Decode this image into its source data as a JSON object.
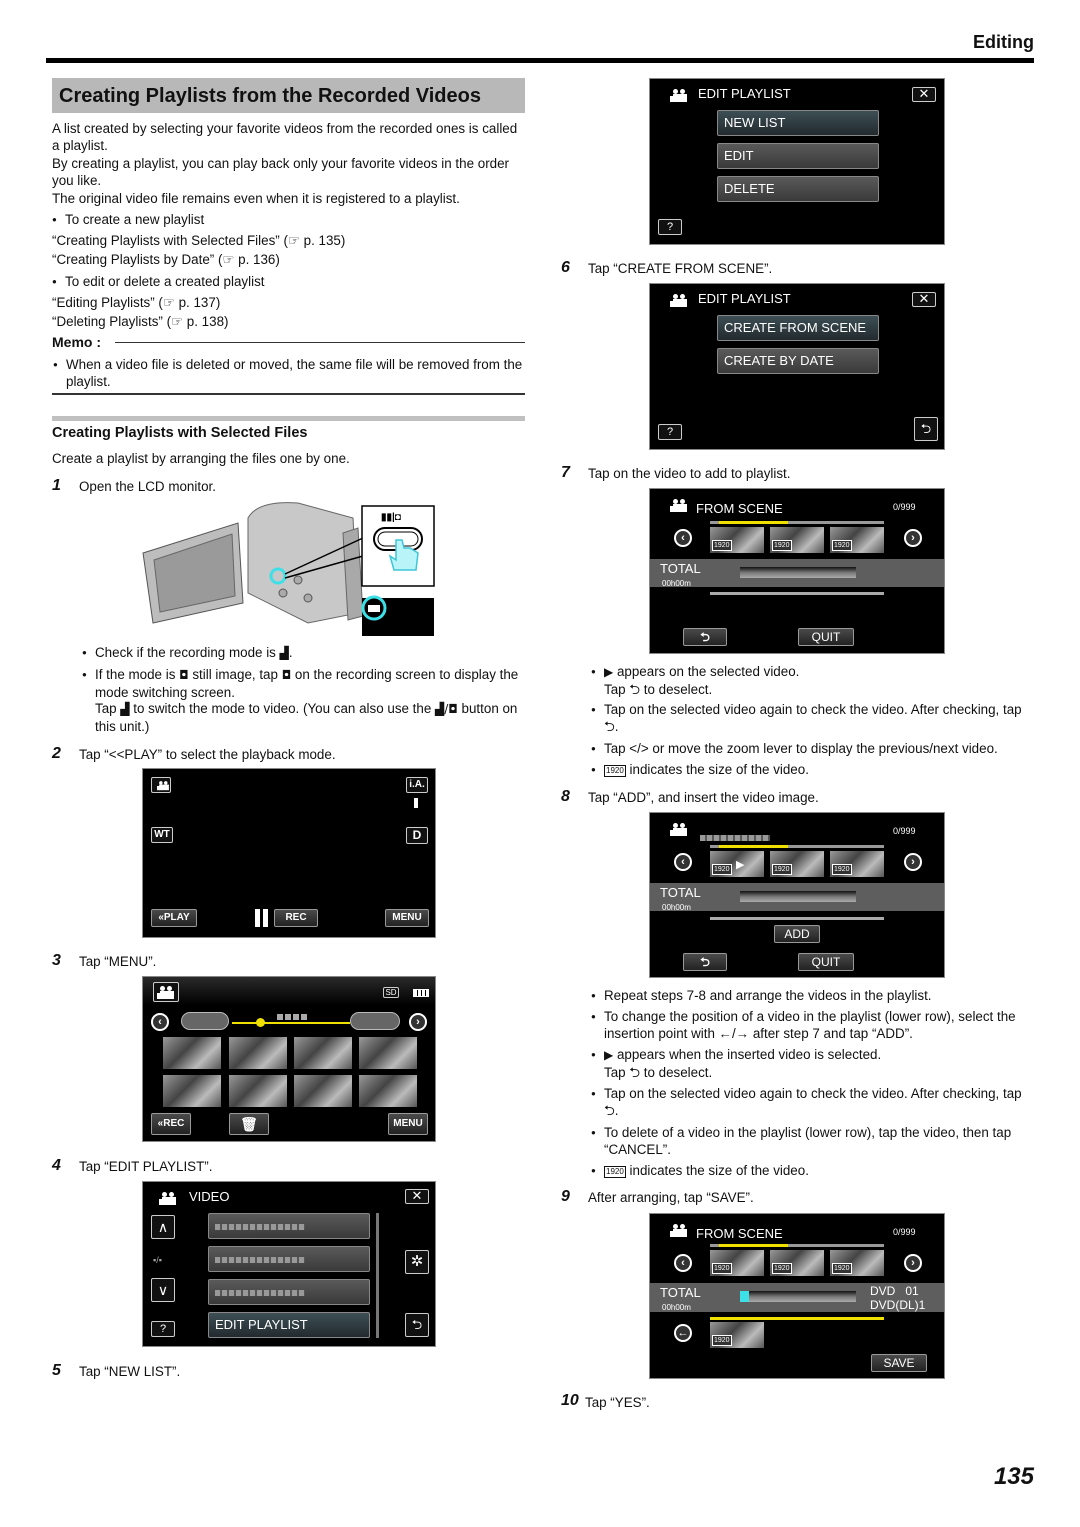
{
  "header": {
    "section": "Editing",
    "page_number": "135"
  },
  "title": "Creating Playlists from the Recorded Videos",
  "intro": {
    "p1": "A list created by selecting your favorite videos from the recorded ones is called a playlist.",
    "p2": "By creating a playlist, you can play back only your favorite videos in the order you like.",
    "p3": "The original video file remains even when it is registered to a playlist.",
    "bullet_new": "To create a new playlist",
    "link_selected": "“Creating Playlists with Selected Files” (☞ p. 135)",
    "link_date": "“Creating Playlists by Date” (☞ p. 136)",
    "bullet_edit": "To edit or delete a created playlist",
    "link_edit": "“Editing Playlists” (☞ p. 137)",
    "link_delete": "“Deleting Playlists” (☞ p. 138)"
  },
  "memo": {
    "heading": "Memo :",
    "item": "When a video file is deleted or moved, the same file will be removed from the playlist."
  },
  "subsection": {
    "title": "Creating Playlists with Selected Files",
    "intro": "Create a playlist by arranging the files one by one."
  },
  "steps": [
    {
      "num": "1",
      "text": "Open the LCD monitor."
    },
    {
      "num": "2",
      "text": "Tap “<<PLAY” to select the playback mode."
    },
    {
      "num": "3",
      "text": "Tap “MENU”."
    },
    {
      "num": "4",
      "text": "Tap “EDIT PLAYLIST”."
    },
    {
      "num": "5",
      "text": "Tap “NEW LIST”."
    },
    {
      "num": "6",
      "text": "Tap “CREATE FROM SCENE”."
    },
    {
      "num": "7",
      "text": "Tap on the video to add to playlist."
    },
    {
      "num": "8",
      "text": "Tap “ADD”, and insert the video image."
    },
    {
      "num": "9",
      "text": "After arranging, tap “SAVE”."
    },
    {
      "num": "10",
      "text": "Tap “YES”."
    }
  ],
  "step1_notes": {
    "check": "Check if the recording mode is ▶▮.",
    "if_still_a": "If the mode is",
    "if_still_b": "still image, tap",
    "if_still_c": "on the recording screen to display the mode switching screen.",
    "tap_a": "Tap",
    "tap_b": "to switch the mode to video. (You can also use the",
    "tap_c": "button on this unit.)",
    "check_pre": "Check if the recording mode is",
    "mode_button_label": "▮▮|◘"
  },
  "screen_rec": {
    "ia": "i.A.",
    "wt": "WT",
    "d": "D",
    "play": "«PLAY",
    "rec": "REC",
    "menu": "MENU"
  },
  "screen_index": {
    "sd": "SD",
    "rec": "«REC",
    "menu": "MENU"
  },
  "screen_video_menu": {
    "title": "VIDEO",
    "page": "▪/▪",
    "edit_playlist": "EDIT PLAYLIST",
    "help": "?"
  },
  "screen_edit_playlist": {
    "title": "EDIT PLAYLIST",
    "items": [
      "NEW LIST",
      "EDIT",
      "DELETE"
    ],
    "help": "?"
  },
  "screen_create": {
    "title": "EDIT PLAYLIST",
    "items": [
      "CREATE FROM SCENE",
      "CREATE BY DATE"
    ],
    "help": "?"
  },
  "screen_scene": {
    "title": "FROM SCENE",
    "count": "0/999",
    "total": "TOTAL",
    "duration": "00h00m",
    "quit": "QUIT",
    "add": "ADD",
    "save": "SAVE",
    "size_tag": "1920",
    "dvd": "DVD   01",
    "dvd_dl": "DVD(DL)1"
  },
  "step7_notes": {
    "n1a": "appears on the selected video.",
    "n1b": "Tap ⮌ to deselect.",
    "n2": "Tap on the selected video again to check the video. After checking, tap ⮌.",
    "n3": "Tap </> or move the zoom lever to display the previous/next video.",
    "n4": "indicates the size of the video."
  },
  "step8_notes": {
    "n1": "Repeat steps 7-8 and arrange the videos in the playlist.",
    "n2": "To change the position of a video in the playlist (lower row), select the insertion point with ←/→ after step 7 and tap “ADD”.",
    "n3a": "appears when the inserted video is selected.",
    "n3b": "Tap ⮌ to deselect.",
    "n4": "Tap on the selected video again to check the video. After checking, tap ⮌.",
    "n5": "To delete of a video in the playlist (lower row), tap the video, then tap “CANCEL”.",
    "n6": "indicates the size of the video."
  },
  "colors": {
    "accent_yellow": "#f0e000",
    "highlight_cyan": "#3ee0e8",
    "title_bg": "#b8b8b8"
  }
}
